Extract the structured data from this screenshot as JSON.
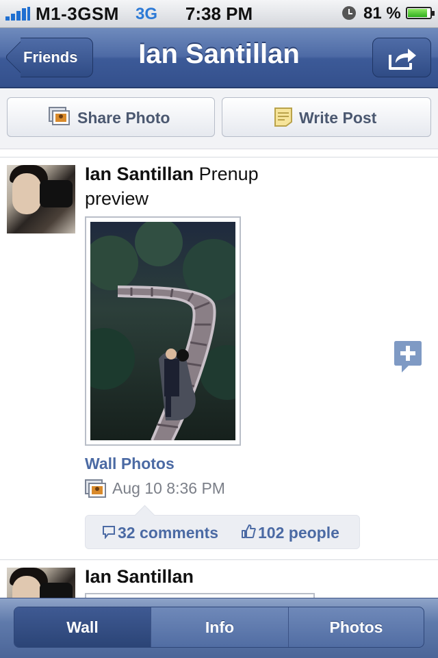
{
  "status_bar": {
    "carrier": "M1-3GSM",
    "network": "3G",
    "time": "7:38 PM",
    "battery": "81 %"
  },
  "nav": {
    "back_label": "Friends",
    "title": "Ian Santillan",
    "share_icon": "share-icon"
  },
  "actions": {
    "share_photo": "Share Photo",
    "write_post": "Write Post"
  },
  "posts": [
    {
      "author": "Ian Santillan",
      "text": "Prenup preview",
      "album": "Wall Photos",
      "date": "Aug 10 8:36 PM",
      "comments": "32 comments",
      "likes": "102 people"
    },
    {
      "author": "Ian Santillan"
    }
  ],
  "tabs": {
    "wall": "Wall",
    "info": "Info",
    "photos": "Photos",
    "selected": "Wall"
  },
  "colors": {
    "nav_blue": "#3c5a98",
    "link_blue": "#4b6aa4",
    "background": "#ffffff"
  }
}
